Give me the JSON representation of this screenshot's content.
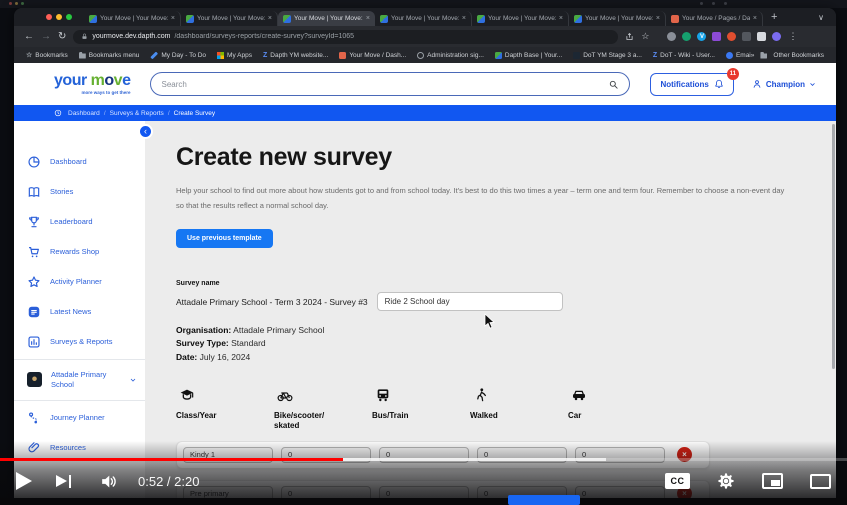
{
  "colors": {
    "accent_blue": "#1157f1",
    "brand_green": "#66b031",
    "brand_navy": "#17327e",
    "brand_blue": "#2563d8",
    "youtube_red": "#ff0000",
    "delete_red": "#cf2014",
    "badge_red": "#e8392e"
  },
  "player": {
    "time_display": "0:52 / 2:20",
    "progress_percent": 40.5,
    "buffer_percent": 71.5
  },
  "browser": {
    "tabs": [
      {
        "title": "Your Move | Your Move: M",
        "favicon": "yourmove"
      },
      {
        "title": "Your Move | Your Move: M",
        "favicon": "yourmove"
      },
      {
        "title": "Your Move | Your Move: M",
        "favicon": "yourmove"
      },
      {
        "title": "Your Move | Your Move: M",
        "favicon": "yourmove"
      },
      {
        "title": "Your Move | Your Move: M",
        "favicon": "yourmove"
      },
      {
        "title": "Your Move | Your Move: M",
        "favicon": "yourmove"
      },
      {
        "title": "Your Move / Pages / Dash",
        "favicon": "jira"
      }
    ],
    "active_tab_index": 2,
    "url": {
      "host": "yourmove.dev.dapth.com",
      "path": "/dashboard/surveys-reports/create-survey?surveyId=1065"
    },
    "extensions": [
      {
        "name": "extension-gray-icon",
        "color": "#8a8f98",
        "glyph": "",
        "square": false
      },
      {
        "name": "extension-green-icon",
        "color": "#15a06e",
        "glyph": "",
        "square": false
      },
      {
        "name": "extension-vimeo-icon",
        "color": "#17a3e8",
        "glyph": "V",
        "square": false
      },
      {
        "name": "extension-purple-icon",
        "color": "#8d4bd6",
        "glyph": "",
        "square": true
      },
      {
        "name": "extension-red-icon",
        "color": "#e04e2f",
        "glyph": "",
        "square": false
      },
      {
        "name": "extensions-puzzle-icon",
        "color": "#53575e",
        "glyph": "",
        "square": true
      },
      {
        "name": "reading-mode-icon",
        "color": "#d7dadf",
        "glyph": "",
        "square": true
      },
      {
        "name": "profile-avatar",
        "color": "#7b6cf0",
        "glyph": "",
        "square": false
      }
    ],
    "bookmarks": [
      {
        "label": "Bookmarks",
        "icon": "star"
      },
      {
        "label": "Bookmarks menu",
        "icon": "folder"
      },
      {
        "label": "My Day - To Do",
        "icon": "pencil"
      },
      {
        "label": "My Apps",
        "icon": "grid"
      },
      {
        "label": "Dapth YM website...",
        "icon": "z"
      },
      {
        "label": "Your Move / Dash...",
        "icon": "jira"
      },
      {
        "label": "Administration sig...",
        "icon": "globe"
      },
      {
        "label": "Dapth Base | Your...",
        "icon": "yourmove"
      },
      {
        "label": "DoT YM Stage 3 a...",
        "icon": "dot"
      },
      {
        "label": "DoT - Wiki - User...",
        "icon": "z"
      },
      {
        "label": "Email - TB",
        "icon": "mail"
      }
    ],
    "overflow_glyph": "»",
    "other_bookmarks_label": "Other Bookmarks"
  },
  "app": {
    "logo": {
      "word1": "your",
      "word2": "move",
      "tagline": "more ways to get there"
    },
    "header": {
      "search_placeholder": "Search",
      "notifications_label": "Notifications",
      "notifications_badge": "11",
      "user_label": "Champion"
    },
    "breadcrumb": [
      "Dashboard",
      "Surveys & Reports",
      "Create Survey"
    ],
    "sidebar": [
      {
        "label": "Dashboard",
        "icon": "pie-chart"
      },
      {
        "label": "Stories",
        "icon": "book"
      },
      {
        "label": "Leaderboard",
        "icon": "trophy"
      },
      {
        "label": "Rewards Shop",
        "icon": "cart"
      },
      {
        "label": "Activity Planner",
        "icon": "star"
      },
      {
        "label": "Latest News",
        "icon": "news"
      },
      {
        "label": "Surveys & Reports",
        "icon": "bar-chart"
      },
      {
        "label": "Attadale Primary School",
        "icon": "school-logo",
        "chevron": true,
        "divider_before": true,
        "divider_after": true
      },
      {
        "label": "Journey Planner",
        "icon": "route"
      },
      {
        "label": "Resources",
        "icon": "paperclip"
      }
    ],
    "main": {
      "title": "Create new survey",
      "description": "Help your school to find out more about how students got to and from school today. It's best to do this two times a year – term one and term four. Remember to choose a non-event day so that the results reflect a normal school day.",
      "template_button_label": "Use previous template",
      "survey_name_label": "Survey name",
      "survey_name_prefix": "Attadale Primary School - Term 3 2024 - Survey #3",
      "survey_name_value": "Ride 2 School day",
      "meta": [
        {
          "label": "Organisation:",
          "value": "Attadale Primary School"
        },
        {
          "label": "Survey Type:",
          "value": "Standard"
        },
        {
          "label": "Date:",
          "value": "July 16, 2024"
        }
      ],
      "columns": [
        {
          "label": "Class/Year",
          "icon": "graduation-cap"
        },
        {
          "label": "Bike/scooter/\nskated",
          "icon": "bicycle"
        },
        {
          "label": "Bus/Train",
          "icon": "bus"
        },
        {
          "label": "Walked",
          "icon": "walk"
        },
        {
          "label": "Car",
          "icon": "car"
        }
      ],
      "rows": [
        {
          "class_year": "Kindy 1",
          "counts": [
            "0",
            "0",
            "0",
            "0"
          ]
        },
        {
          "class_year": "Pre primary",
          "counts": [
            "0",
            "0",
            "0",
            "0"
          ]
        }
      ]
    }
  }
}
